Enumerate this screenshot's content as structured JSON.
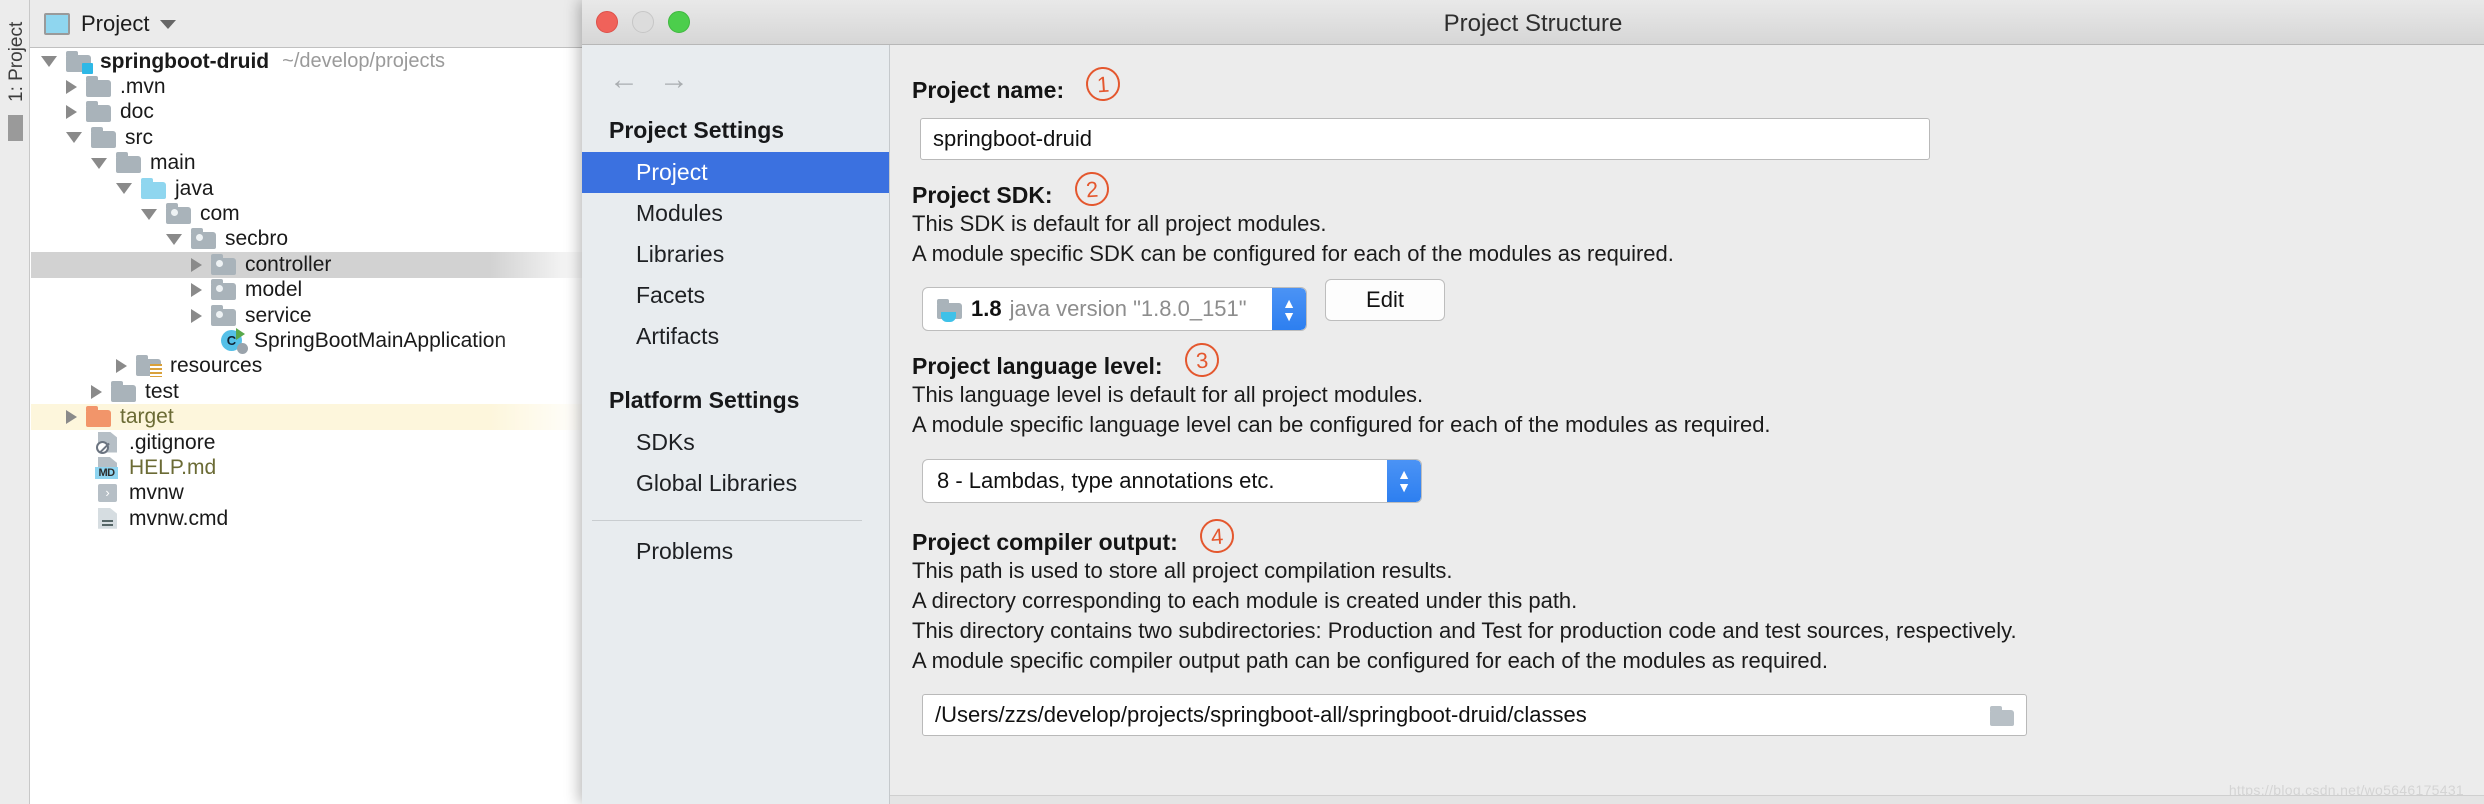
{
  "ide": {
    "left_strip_label": "1: Project",
    "toolbar": {
      "project_label": "Project",
      "project_icon": "project-window-icon",
      "dropdown_icon": "chevron-down-icon"
    },
    "tree": [
      {
        "label": "springboot-druid",
        "path": "~/develop/projects",
        "arrow": "down",
        "icon": "module-folder-icon",
        "indent": 0,
        "state": "normal",
        "bold": true
      },
      {
        "label": ".mvn",
        "arrow": "right",
        "icon": "folder-icon",
        "indent": 1,
        "state": "normal"
      },
      {
        "label": "doc",
        "arrow": "right",
        "icon": "folder-icon",
        "indent": 1,
        "state": "normal"
      },
      {
        "label": "src",
        "arrow": "down",
        "icon": "folder-icon",
        "indent": 1,
        "state": "normal"
      },
      {
        "label": "main",
        "arrow": "down",
        "icon": "folder-icon",
        "indent": 2,
        "state": "normal"
      },
      {
        "label": "java",
        "arrow": "down",
        "icon": "source-folder-icon",
        "indent": 3,
        "state": "normal"
      },
      {
        "label": "com",
        "arrow": "down",
        "icon": "package-icon",
        "indent": 4,
        "state": "normal"
      },
      {
        "label": "secbro",
        "arrow": "down",
        "icon": "package-icon",
        "indent": 5,
        "state": "normal"
      },
      {
        "label": "controller",
        "arrow": "right",
        "icon": "package-icon",
        "indent": 6,
        "state": "selected"
      },
      {
        "label": "model",
        "arrow": "right",
        "icon": "package-icon",
        "indent": 6,
        "state": "normal"
      },
      {
        "label": "service",
        "arrow": "right",
        "icon": "package-icon",
        "indent": 6,
        "state": "normal"
      },
      {
        "label": "SpringBootMainApplication",
        "arrow": "none",
        "icon": "java-class-runnable-icon",
        "indent": 6,
        "state": "normal"
      },
      {
        "label": "resources",
        "arrow": "right",
        "icon": "resources-folder-icon",
        "indent": 3,
        "state": "normal"
      },
      {
        "label": "test",
        "arrow": "right",
        "icon": "folder-icon",
        "indent": 2,
        "state": "normal"
      },
      {
        "label": "target",
        "arrow": "right",
        "icon": "excluded-folder-icon",
        "indent": 1,
        "state": "highlight",
        "olive": true
      },
      {
        "label": ".gitignore",
        "arrow": "none",
        "icon": "gitignore-file-icon",
        "indent": 1,
        "state": "normal"
      },
      {
        "label": "HELP.md",
        "arrow": "none",
        "icon": "markdown-file-icon",
        "indent": 1,
        "state": "normal",
        "olive": true
      },
      {
        "label": "mvnw",
        "arrow": "none",
        "icon": "shell-script-icon",
        "indent": 1,
        "state": "normal"
      },
      {
        "label": "mvnw.cmd",
        "arrow": "none",
        "icon": "text-file-icon",
        "indent": 1,
        "state": "normal"
      }
    ]
  },
  "dialog": {
    "title": "Project Structure",
    "window_buttons": [
      "close-button",
      "minimize-button",
      "maximize-button"
    ],
    "nav": {
      "back_icon": "arrow-left-icon",
      "forward_icon": "arrow-right-icon",
      "groups": [
        {
          "title": "Project Settings",
          "items": [
            {
              "label": "Project",
              "active": true
            },
            {
              "label": "Modules",
              "active": false
            },
            {
              "label": "Libraries",
              "active": false
            },
            {
              "label": "Facets",
              "active": false
            },
            {
              "label": "Artifacts",
              "active": false
            }
          ]
        },
        {
          "title": "Platform Settings",
          "items": [
            {
              "label": "SDKs",
              "active": false
            },
            {
              "label": "Global Libraries",
              "active": false
            }
          ]
        }
      ],
      "footer_item": {
        "label": "Problems",
        "active": false
      }
    },
    "sections": {
      "project_name": {
        "label": "Project name:",
        "badge": "1",
        "value": "springboot-druid"
      },
      "project_sdk": {
        "label": "Project SDK:",
        "badge": "2",
        "desc_line1": "This SDK is default for all project modules.",
        "desc_line2": "A module specific SDK can be configured for each of the modules as required.",
        "sdk_version": "1.8",
        "sdk_detail": "java version \"1.8.0_151\"",
        "sdk_icon": "java-sdk-folder-icon",
        "stepper_up": "▲",
        "stepper_down": "▼",
        "edit_button": "Edit"
      },
      "language_level": {
        "label": "Project language level:",
        "badge": "3",
        "desc_line1": "This language level is default for all project modules.",
        "desc_line2": "A module specific language level can be configured for each of the modules as required.",
        "value": "8 - Lambdas, type annotations etc."
      },
      "compiler_output": {
        "label": "Project compiler output:",
        "badge": "4",
        "desc_line1": "This path is used to store all project compilation results.",
        "desc_line2": "A directory corresponding to each module is created under this path.",
        "desc_line3": "This directory contains two subdirectories: Production and Test for production code and test sources, respectively.",
        "desc_line4": "A module specific compiler output path can be configured for each of the modules as required.",
        "value": "/Users/zzs/develop/projects/springboot-all/springboot-druid/classes",
        "browse_icon": "browse-folder-icon"
      }
    },
    "watermark": "https://blog.csdn.net/wo5646175431"
  },
  "colors": {
    "accent_blue": "#3b71e0",
    "badge_orange": "#e4572e",
    "selection_gray": "#d2d2d2",
    "highlight_yellow": "#fdf6dc"
  }
}
